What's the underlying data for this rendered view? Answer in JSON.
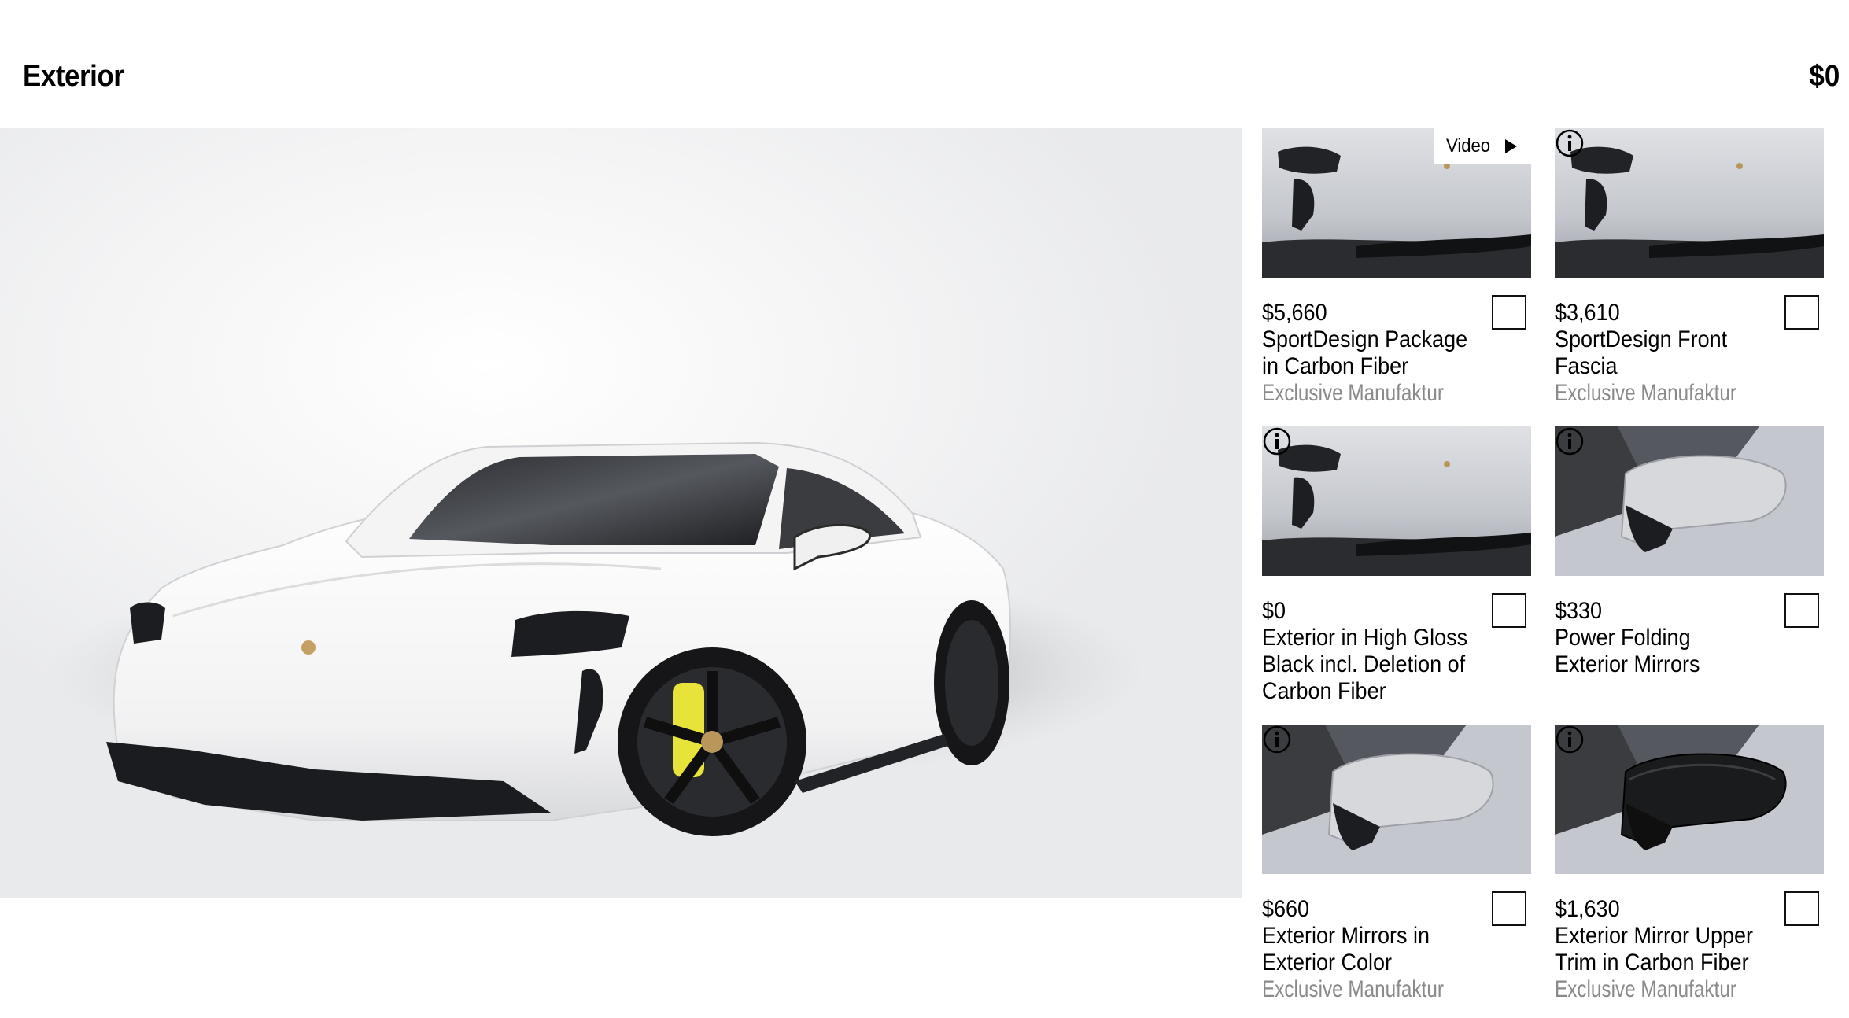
{
  "header": {
    "title": "Exterior",
    "total": "$0"
  },
  "gallery": {
    "slide_count": 6,
    "active_index": 0,
    "accent_color": "#d5001c"
  },
  "options": [
    {
      "price": "$5,660",
      "name": "SportDesign Package in Carbon Fiber",
      "subtitle": "Exclusive Manufaktur",
      "badge": "Video",
      "thumb": "front-fascia",
      "checked": false
    },
    {
      "price": "$3,610",
      "name": "SportDesign Front Fascia",
      "subtitle": "Exclusive Manufaktur",
      "badge": "info",
      "thumb": "front-fascia",
      "checked": false
    },
    {
      "price": "$0",
      "name": "Exterior in High Gloss Black incl. Deletion of Carbon Fiber",
      "subtitle": "",
      "badge": "info",
      "thumb": "front-fascia",
      "checked": false
    },
    {
      "price": "$330",
      "name": "Power Folding Exterior Mirrors",
      "subtitle": "",
      "badge": "info",
      "thumb": "mirror-silver",
      "checked": false
    },
    {
      "price": "$660",
      "name": "Exterior Mirrors in Exterior Color",
      "subtitle": "Exclusive Manufaktur",
      "badge": "info",
      "thumb": "mirror-silver",
      "checked": false
    },
    {
      "price": "$1,630",
      "name": "Exterior Mirror Upper Trim in Carbon Fiber",
      "subtitle": "Exclusive Manufaktur",
      "badge": "info",
      "thumb": "mirror-carbon",
      "checked": false
    }
  ]
}
